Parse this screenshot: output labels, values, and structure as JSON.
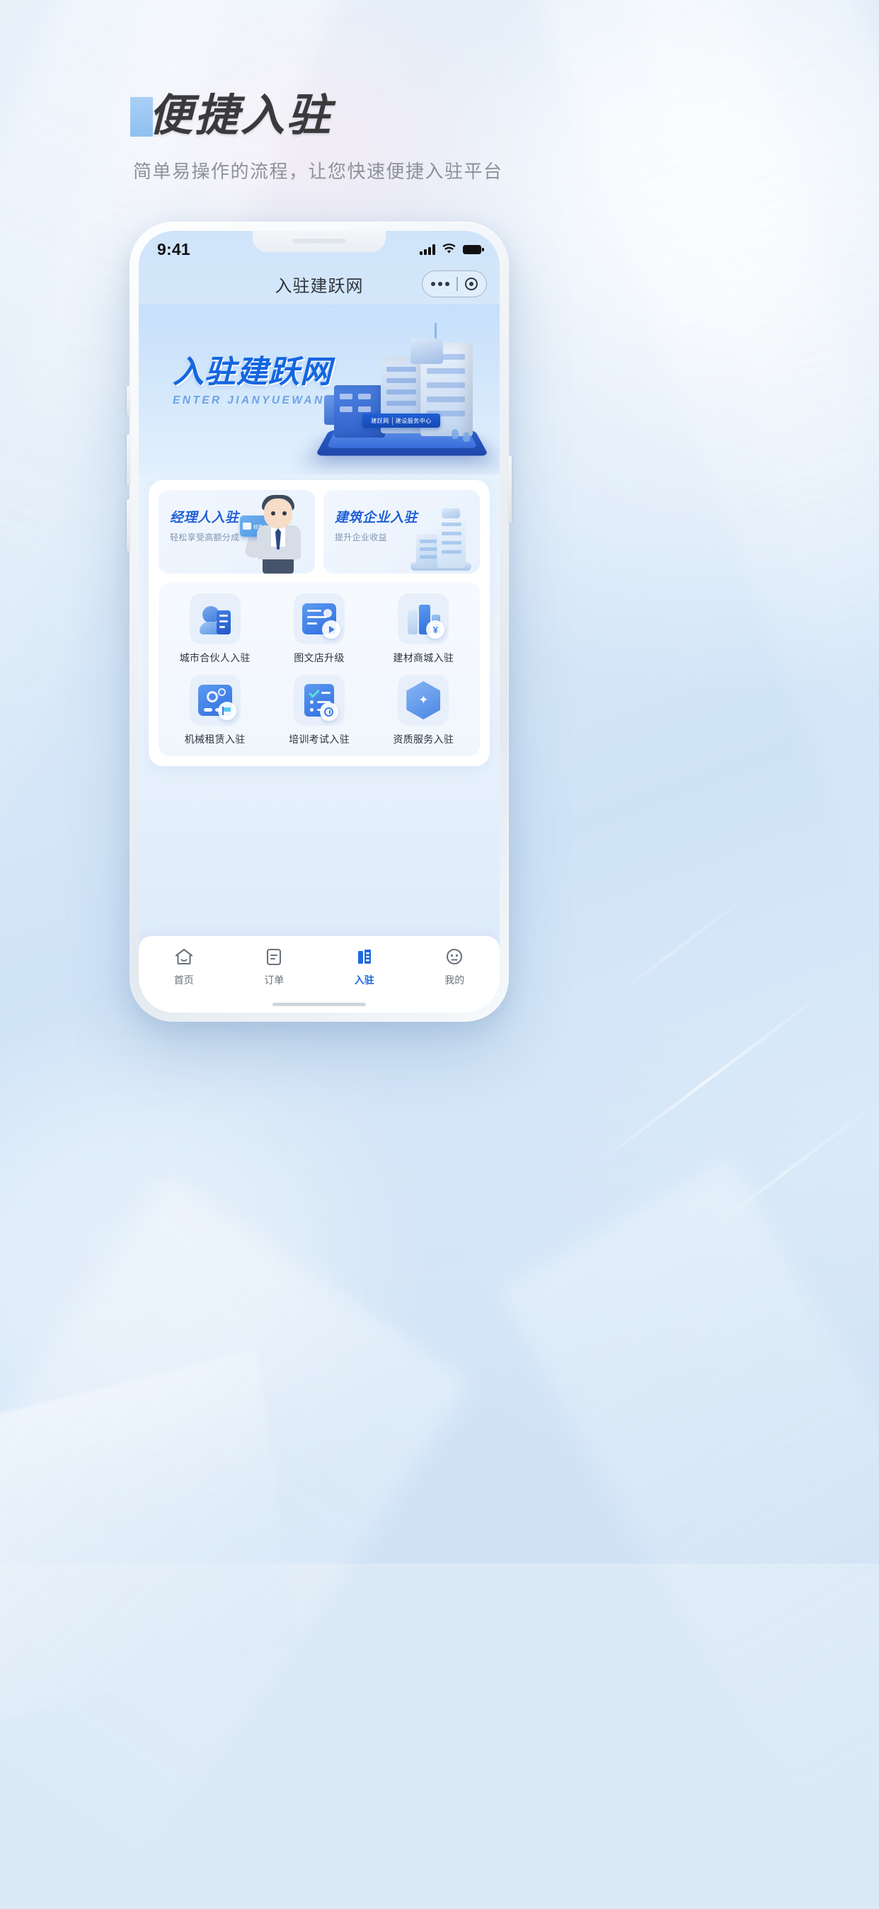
{
  "page": {
    "headline": "便捷入驻",
    "subheadline": "简单易操作的流程，让您快速便捷入驻平台",
    "accent_color": "#1f6ae0"
  },
  "phone": {
    "status_bar": {
      "time": "9:41",
      "signal_icon": "signal-bars-icon",
      "wifi_icon": "wifi-icon",
      "battery_icon": "battery-full-icon"
    },
    "nav": {
      "title": "入驻建跃网",
      "capsule": {
        "more_icon": "more-dots-icon",
        "target_icon": "target-circle-icon"
      }
    },
    "banner": {
      "title_zh": "入驻建跃网",
      "title_en": "ENTER JIANYUEWANG",
      "sign_left": "建跃网",
      "sign_right": "建设服务中心",
      "illustration": "isometric-building-illustration"
    },
    "promos": [
      {
        "title": "经理人入驻",
        "subtitle": "轻松享受高额分成",
        "illustration": "manager-person-illustration",
        "card_label": "经理人"
      },
      {
        "title": "建筑企业入驻",
        "subtitle": "提升企业收益",
        "illustration": "company-building-illustration"
      }
    ],
    "grid": [
      {
        "label": "城市合伙人入驻",
        "icon": "city-partner-icon"
      },
      {
        "label": "图文店升级",
        "icon": "graphic-shop-icon"
      },
      {
        "label": "建材商城入驻",
        "icon": "material-mall-icon"
      },
      {
        "label": "机械租赁入驻",
        "icon": "machinery-rental-icon"
      },
      {
        "label": "培训考试入驻",
        "icon": "training-exam-icon"
      },
      {
        "label": "资质服务入驻",
        "icon": "qualification-service-icon"
      }
    ],
    "tabbar": [
      {
        "label": "首页",
        "icon": "home-icon",
        "active": false
      },
      {
        "label": "订单",
        "icon": "order-icon",
        "active": false
      },
      {
        "label": "入驻",
        "icon": "settle-in-icon",
        "active": true
      },
      {
        "label": "我的",
        "icon": "profile-icon",
        "active": false
      }
    ]
  }
}
